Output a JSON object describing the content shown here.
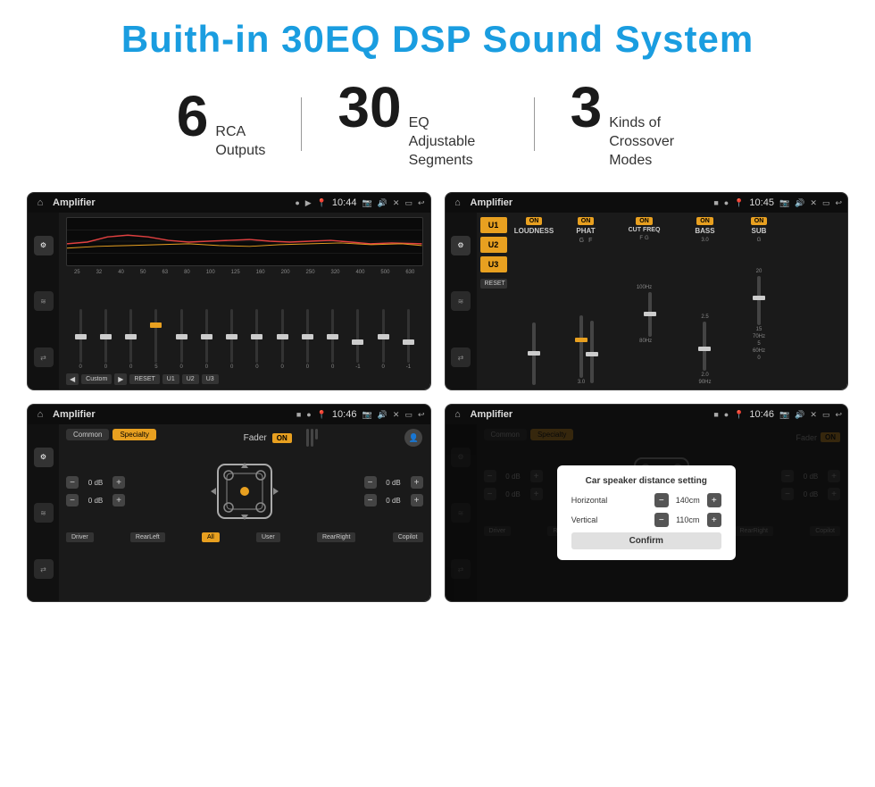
{
  "header": {
    "title": "Buith-in 30EQ DSP Sound System"
  },
  "stats": [
    {
      "number": "6",
      "desc_line1": "RCA",
      "desc_line2": "Outputs"
    },
    {
      "number": "30",
      "desc_line1": "EQ Adjustable",
      "desc_line2": "Segments"
    },
    {
      "number": "3",
      "desc_line1": "Kinds of",
      "desc_line2": "Crossover Modes"
    }
  ],
  "screen1": {
    "title": "Amplifier",
    "time": "10:44",
    "freq_labels": [
      "25",
      "32",
      "40",
      "50",
      "63",
      "80",
      "100",
      "125",
      "160",
      "200",
      "250",
      "320",
      "400",
      "500",
      "630"
    ],
    "slider_values": [
      "0",
      "0",
      "0",
      "5",
      "0",
      "0",
      "0",
      "0",
      "0",
      "0",
      "0",
      "-1",
      "0",
      "-1"
    ],
    "bottom_btns": [
      "Custom",
      "RESET",
      "U1",
      "U2",
      "U3"
    ]
  },
  "screen2": {
    "title": "Amplifier",
    "time": "10:45",
    "u_buttons": [
      "U1",
      "U2",
      "U3"
    ],
    "channels": [
      {
        "on": true,
        "name": "LOUDNESS"
      },
      {
        "on": true,
        "name": "PHAT"
      },
      {
        "on": true,
        "name": "CUT FREQ"
      },
      {
        "on": true,
        "name": "BASS"
      },
      {
        "on": true,
        "name": "SUB"
      }
    ],
    "reset_label": "RESET"
  },
  "screen3": {
    "title": "Amplifier",
    "time": "10:46",
    "tabs": [
      "Common",
      "Specialty"
    ],
    "fader_label": "Fader",
    "fader_on": "ON",
    "volumes": [
      "0 dB",
      "0 dB",
      "0 dB",
      "0 dB"
    ],
    "bottom_btns": [
      "Driver",
      "RearLeft",
      "All",
      "User",
      "RearRight",
      "Copilot"
    ]
  },
  "screen4": {
    "title": "Amplifier",
    "time": "10:46",
    "tabs": [
      "Common",
      "Specialty"
    ],
    "dialog": {
      "title": "Car speaker distance setting",
      "horizontal_label": "Horizontal",
      "horizontal_value": "140cm",
      "vertical_label": "Vertical",
      "vertical_value": "110cm",
      "confirm_label": "Confirm"
    },
    "bottom_btns": [
      "Driver",
      "RearLeft",
      "All",
      "User",
      "RearRight",
      "Copilot"
    ]
  }
}
